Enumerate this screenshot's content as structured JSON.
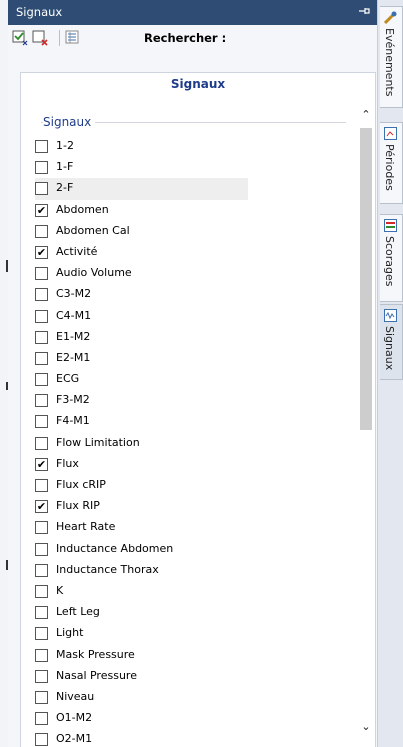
{
  "panel": {
    "title": "Signaux",
    "pin_icon": "pin-icon"
  },
  "toolbar": {
    "search_label": "Rechercher :",
    "search_value": ""
  },
  "subheader": {
    "title": "Signaux"
  },
  "group": {
    "title": "Signaux"
  },
  "signals": [
    {
      "label": "1-2",
      "checked": false
    },
    {
      "label": "1-F",
      "checked": false
    },
    {
      "label": "2-F",
      "checked": false
    },
    {
      "label": "Abdomen",
      "checked": true
    },
    {
      "label": "Abdomen Cal",
      "checked": false
    },
    {
      "label": "Activité",
      "checked": true
    },
    {
      "label": "Audio Volume",
      "checked": false
    },
    {
      "label": "C3-M2",
      "checked": false
    },
    {
      "label": "C4-M1",
      "checked": false
    },
    {
      "label": "E1-M2",
      "checked": false
    },
    {
      "label": "E2-M1",
      "checked": false
    },
    {
      "label": "ECG",
      "checked": false
    },
    {
      "label": "F3-M2",
      "checked": false
    },
    {
      "label": "F4-M1",
      "checked": false
    },
    {
      "label": "Flow Limitation",
      "checked": false
    },
    {
      "label": "Flux",
      "checked": true
    },
    {
      "label": "Flux cRIP",
      "checked": false
    },
    {
      "label": "Flux RIP",
      "checked": true
    },
    {
      "label": "Heart Rate",
      "checked": false
    },
    {
      "label": "Inductance Abdomen",
      "checked": false
    },
    {
      "label": "Inductance Thorax",
      "checked": false
    },
    {
      "label": "K",
      "checked": false
    },
    {
      "label": "Left Leg",
      "checked": false
    },
    {
      "label": "Light",
      "checked": false
    },
    {
      "label": "Mask Pressure",
      "checked": false
    },
    {
      "label": "Nasal Pressure",
      "checked": false
    },
    {
      "label": "Niveau",
      "checked": false
    },
    {
      "label": "O1-M2",
      "checked": false
    },
    {
      "label": "O2-M1",
      "checked": false
    }
  ],
  "highlighted_row": "2-F",
  "tabs": [
    {
      "label": "Evénements",
      "icon": "events-icon",
      "active": false
    },
    {
      "label": "Périodes",
      "icon": "periods-icon",
      "active": false
    },
    {
      "label": "Scorages",
      "icon": "scoring-icon",
      "active": false
    },
    {
      "label": "Signaux",
      "icon": "signals-icon",
      "active": true
    }
  ],
  "colors": {
    "titlebar": "#2f4d74",
    "accent_text": "#1f3c8c",
    "check_green": "#2e8b2e",
    "check_red": "#d22a2a",
    "panel_bg": "#f4f6fa"
  }
}
